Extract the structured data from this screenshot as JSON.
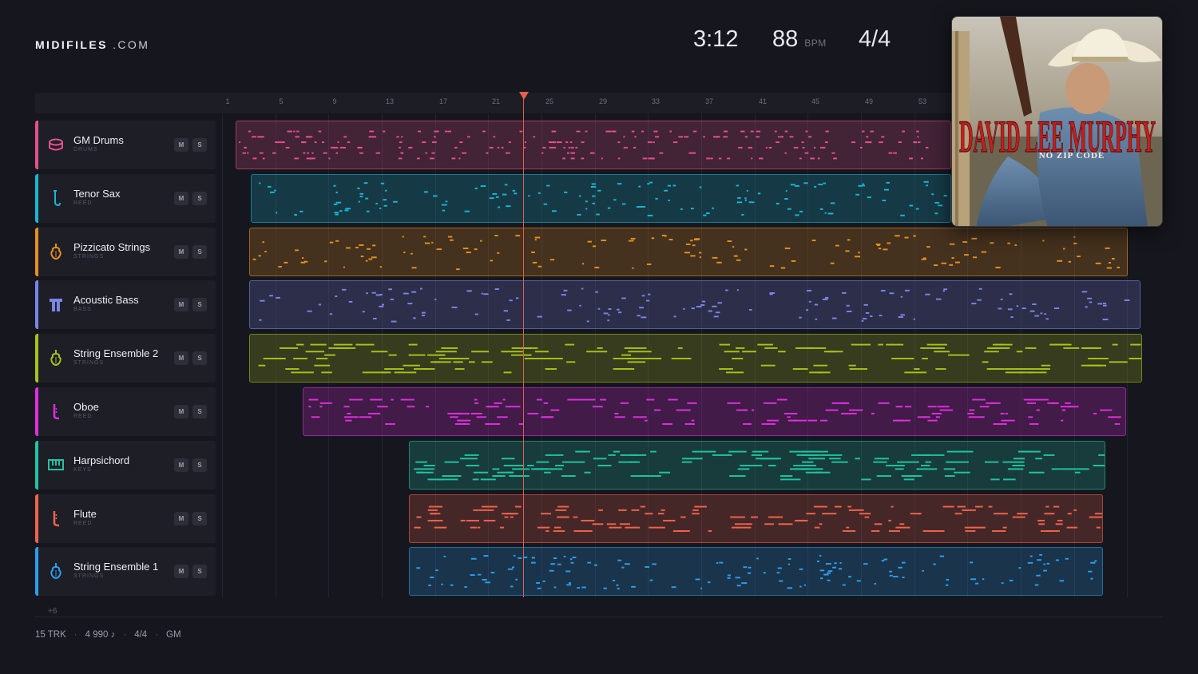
{
  "brand": {
    "name": "MIDIFILES",
    "domain": ".COM"
  },
  "transport": {
    "time": "3:12",
    "tempo": "88",
    "tempo_unit": "BPM",
    "time_signature": "4/4"
  },
  "album_cover": {
    "artist": "DAVID LEE MURPHY",
    "title": "NO ZIP CODE"
  },
  "ruler": {
    "ticks": [
      "1",
      "5",
      "9",
      "13",
      "17",
      "21",
      "25",
      "29",
      "33",
      "37",
      "41",
      "45",
      "49",
      "53"
    ]
  },
  "tracks": [
    {
      "name": "GM Drums",
      "category": "DRUMS",
      "color": "#e5508c",
      "icon": "drum-icon",
      "mute": "M",
      "solo": "S"
    },
    {
      "name": "Tenor Sax",
      "category": "REED",
      "color": "#17b7d6",
      "icon": "sax-icon",
      "mute": "M",
      "solo": "S"
    },
    {
      "name": "Pizzicato Strings",
      "category": "STRINGS",
      "color": "#e8901f",
      "icon": "violin-icon",
      "mute": "M",
      "solo": "S"
    },
    {
      "name": "Acoustic Bass",
      "category": "BASS",
      "color": "#7a86e6",
      "icon": "bass-icon",
      "mute": "M",
      "solo": "S"
    },
    {
      "name": "String Ensemble 2",
      "category": "STRINGS",
      "color": "#a8c21c",
      "icon": "violin-icon",
      "mute": "M",
      "solo": "S"
    },
    {
      "name": "Oboe",
      "category": "REED",
      "color": "#df2fe0",
      "icon": "oboe-icon",
      "mute": "M",
      "solo": "S"
    },
    {
      "name": "Harpsichord",
      "category": "KEYS",
      "color": "#1fc4a4",
      "icon": "keyboard-icon",
      "mute": "M",
      "solo": "S"
    },
    {
      "name": "Flute",
      "category": "REED",
      "color": "#f0644c",
      "icon": "flute-icon",
      "mute": "M",
      "solo": "S"
    },
    {
      "name": "String Ensemble 1",
      "category": "STRINGS",
      "color": "#2a9ff0",
      "icon": "violin-icon",
      "mute": "M",
      "solo": "S"
    }
  ],
  "more_tracks": "+6",
  "footer": {
    "tracks": "15 TRK",
    "notes": "4 990 ♪",
    "meter": "4/4",
    "standard": "GM",
    "sep": "·"
  }
}
